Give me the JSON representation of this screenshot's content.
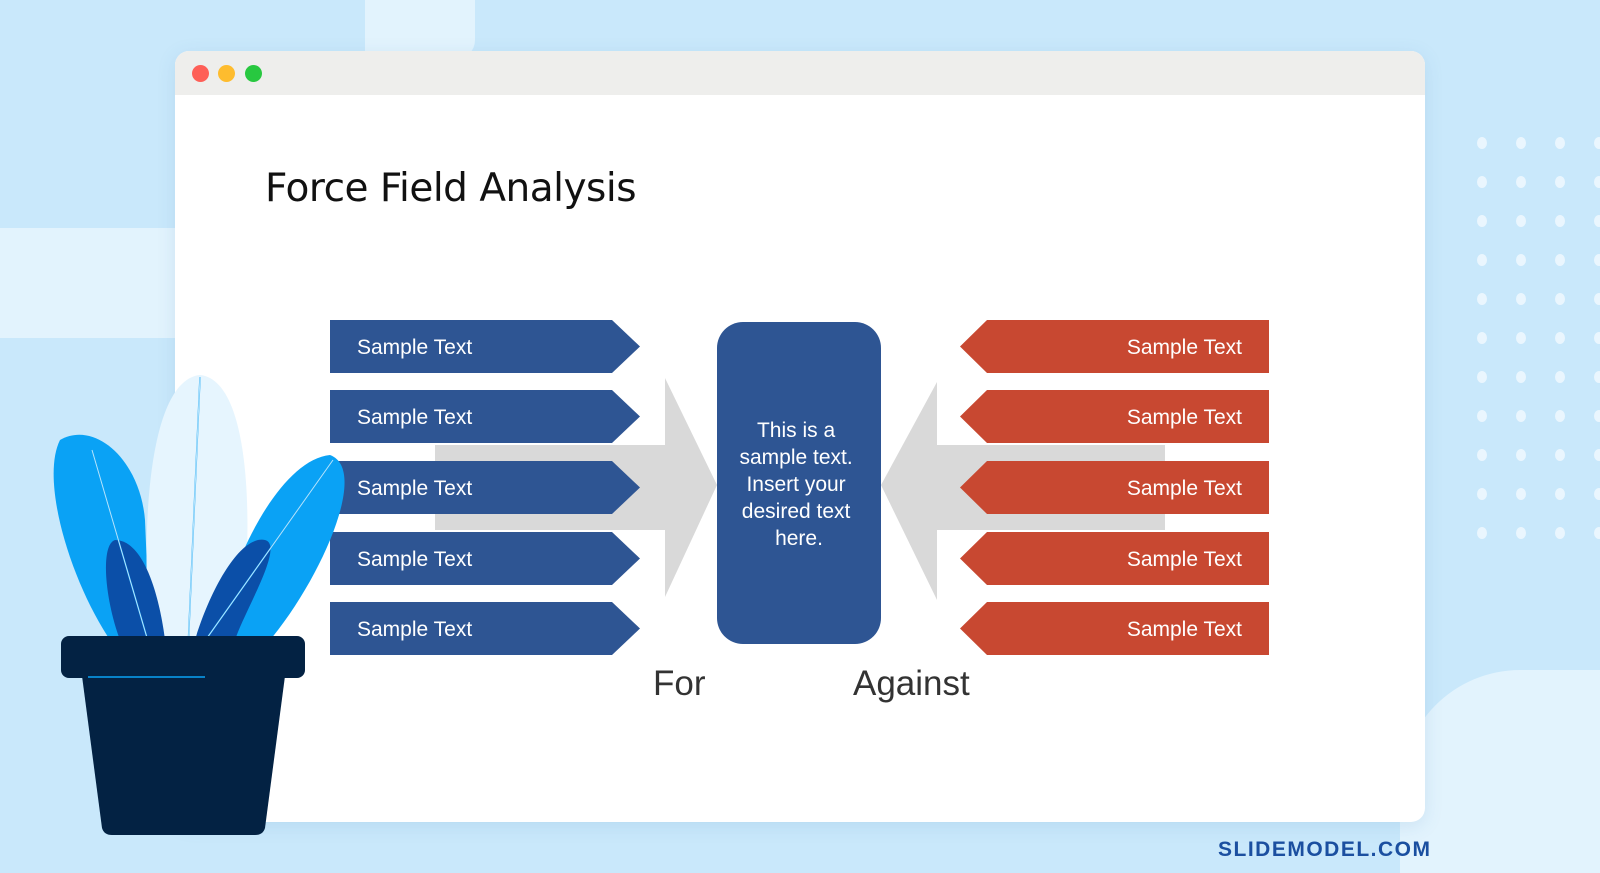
{
  "window": {
    "controls": [
      "close",
      "minimize",
      "maximize"
    ],
    "colors": {
      "close": "#fe5f57",
      "minimize": "#febc2e",
      "maximize": "#28c840"
    }
  },
  "slide": {
    "title": "Force Field Analysis",
    "for_items": [
      "Sample Text",
      "Sample Text",
      "Sample Text",
      "Sample Text",
      "Sample Text"
    ],
    "against_items": [
      "Sample Text",
      "Sample Text",
      "Sample Text",
      "Sample Text",
      "Sample Text"
    ],
    "center_text": [
      "This is a",
      "sample text.",
      "Insert your",
      "desired text",
      "here."
    ],
    "for_label": "For",
    "against_label": "Against",
    "colors": {
      "for": "#2e5593",
      "against": "#c84831",
      "center": "#2e5593",
      "arrow": "#d9d9d9"
    }
  },
  "brand": "SLIDEMODEL.COM"
}
